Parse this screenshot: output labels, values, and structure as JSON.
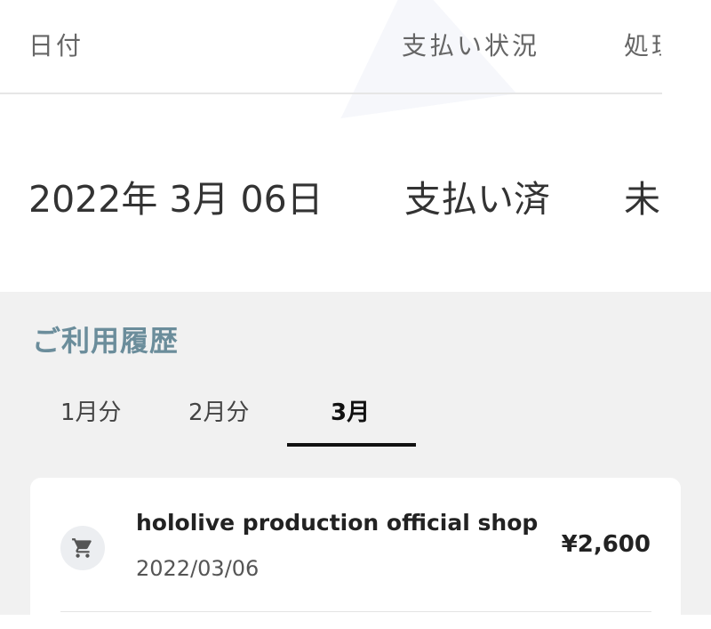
{
  "summary": {
    "headers": {
      "date": "日付",
      "status": "支払い状況",
      "processing": "処理"
    },
    "row": {
      "date": "2022年 3月 06日",
      "status": "支払い済",
      "processing": "未"
    }
  },
  "history": {
    "title": "ご利用履歴",
    "tabs": [
      {
        "label": "1月分",
        "active": false
      },
      {
        "label": "2月分",
        "active": false
      },
      {
        "label": "3月",
        "active": true
      }
    ],
    "transactions": [
      {
        "merchant": "hololive production official shop",
        "date": "2022/03/06",
        "amount": "¥2,600",
        "icon": "cart-icon"
      }
    ]
  },
  "colors": {
    "section_title": "#6b8d9b",
    "background_gray": "#f1f1f1",
    "active_tab": "#111111"
  }
}
